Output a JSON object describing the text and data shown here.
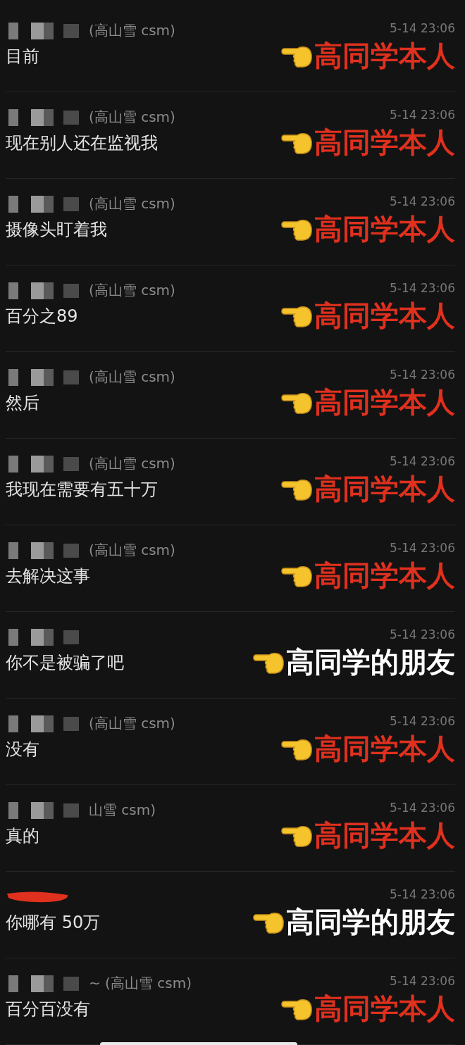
{
  "messages": [
    {
      "sender": "(高山雪 csm)",
      "kind": "blurred",
      "time": "5-14 23:06",
      "text": "目前",
      "note": "高同学本人",
      "color": "#e0301e"
    },
    {
      "sender": "(高山雪 csm)",
      "kind": "blurred",
      "time": "5-14 23:06",
      "text": "现在别人还在监视我",
      "note": "高同学本人",
      "color": "#e0301e"
    },
    {
      "sender": "(高山雪 csm)",
      "kind": "blurred",
      "time": "5-14 23:06",
      "text": "摄像头盯着我",
      "note": "高同学本人",
      "color": "#e0301e"
    },
    {
      "sender": "(高山雪 csm)",
      "kind": "blurred",
      "time": "5-14 23:06",
      "text": "百分之89",
      "note": "高同学本人",
      "color": "#e0301e"
    },
    {
      "sender": "(高山雪 csm)",
      "kind": "blurred",
      "time": "5-14 23:06",
      "text": "然后",
      "note": "高同学本人",
      "color": "#e0301e"
    },
    {
      "sender": "(高山雪 csm)",
      "kind": "blurred",
      "time": "5-14 23:06",
      "text": "我现在需要有五十万",
      "note": "高同学本人",
      "color": "#e0301e"
    },
    {
      "sender": "(高山雪 csm)",
      "kind": "blurred",
      "time": "5-14 23:06",
      "text": "去解决这事",
      "note": "高同学本人",
      "color": "#e0301e"
    },
    {
      "kind": "blurred",
      "time": "5-14 23:06",
      "text": "你不是被骗了吧",
      "note": "高同学的朋友",
      "color": "#ffffff"
    },
    {
      "sender": "(高山雪 csm)",
      "kind": "blurred",
      "time": "5-14 23:06",
      "text": "没有",
      "note": "高同学本人",
      "color": "#e0301e"
    },
    {
      "sender": "山雪 csm)",
      "kind": "blurred",
      "time": "5-14 23:06",
      "text": "真的",
      "note": "高同学本人",
      "color": "#e0301e"
    },
    {
      "kind": "scribbled",
      "time": "5-14 23:06",
      "text": "你哪有 50万",
      "note": "高同学的朋友",
      "color": "#ffffff"
    },
    {
      "sender": "~ (高山雪 csm)",
      "kind": "blurred",
      "time": "5-14 23:06",
      "text": "百分百没有",
      "note": "高同学本人",
      "color": "#e0301e"
    }
  ]
}
